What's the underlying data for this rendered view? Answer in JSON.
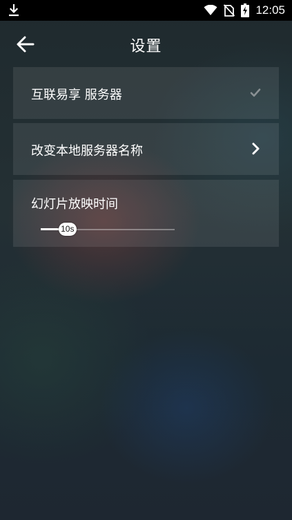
{
  "status_bar": {
    "time": "12:05",
    "icons": [
      "download-icon",
      "wifi-icon",
      "no-sim-icon",
      "battery-charging-icon"
    ]
  },
  "header": {
    "title": "设置",
    "back_icon": "arrow-left-icon"
  },
  "settings": {
    "share_server": {
      "label": "互联易享 服务器",
      "checked": true,
      "icon": "check-icon"
    },
    "rename_server": {
      "label": "改变本地服务器名称",
      "icon": "chevron-right-icon"
    },
    "slideshow_interval": {
      "label": "幻灯片放映时间",
      "value_label": "10s",
      "level": 0.2
    }
  },
  "colors": {
    "status_bar_bg": "#000000",
    "card_bg": "rgba(255,255,255,0.09)",
    "text": "#ffffff",
    "check_color": "#8a9194"
  }
}
